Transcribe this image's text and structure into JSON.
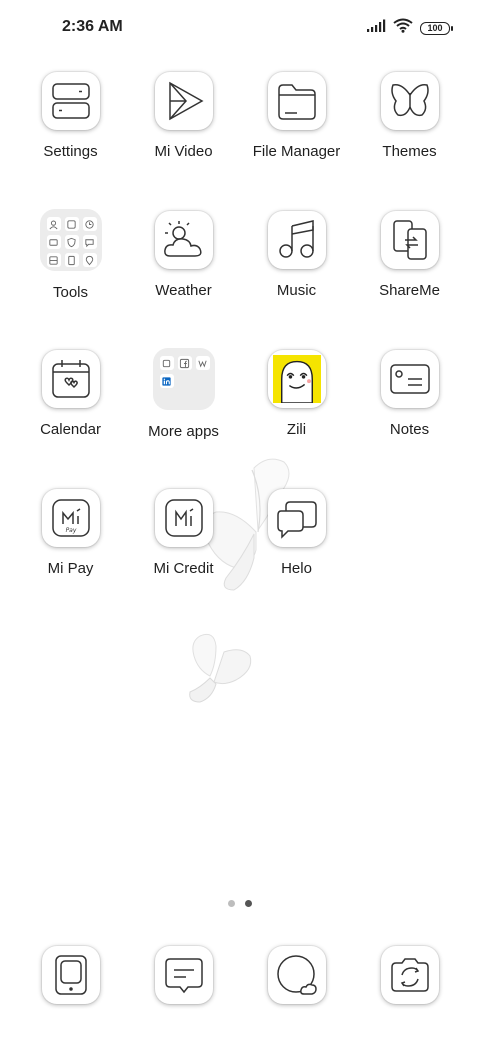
{
  "status": {
    "time": "2:36 AM",
    "battery": "100"
  },
  "apps": [
    {
      "label": "Settings"
    },
    {
      "label": "Mi Video"
    },
    {
      "label": "File Manager"
    },
    {
      "label": "Themes"
    },
    {
      "label": "Tools"
    },
    {
      "label": "Weather"
    },
    {
      "label": "Music"
    },
    {
      "label": "ShareMe"
    },
    {
      "label": "Calendar"
    },
    {
      "label": "More apps"
    },
    {
      "label": "Zili"
    },
    {
      "label": "Notes"
    },
    {
      "label": "Mi Pay"
    },
    {
      "label": "Mi Credit"
    },
    {
      "label": "Helo"
    }
  ],
  "pager": {
    "pages": 2,
    "current": 2
  },
  "dock": [
    {
      "icon": "phone-icon"
    },
    {
      "icon": "messages-icon"
    },
    {
      "icon": "browser-icon"
    },
    {
      "icon": "camera-icon"
    }
  ],
  "colors": {
    "background": "#ffffff",
    "icon_stroke": "#333333",
    "zili_yellow": "#f5e400"
  }
}
